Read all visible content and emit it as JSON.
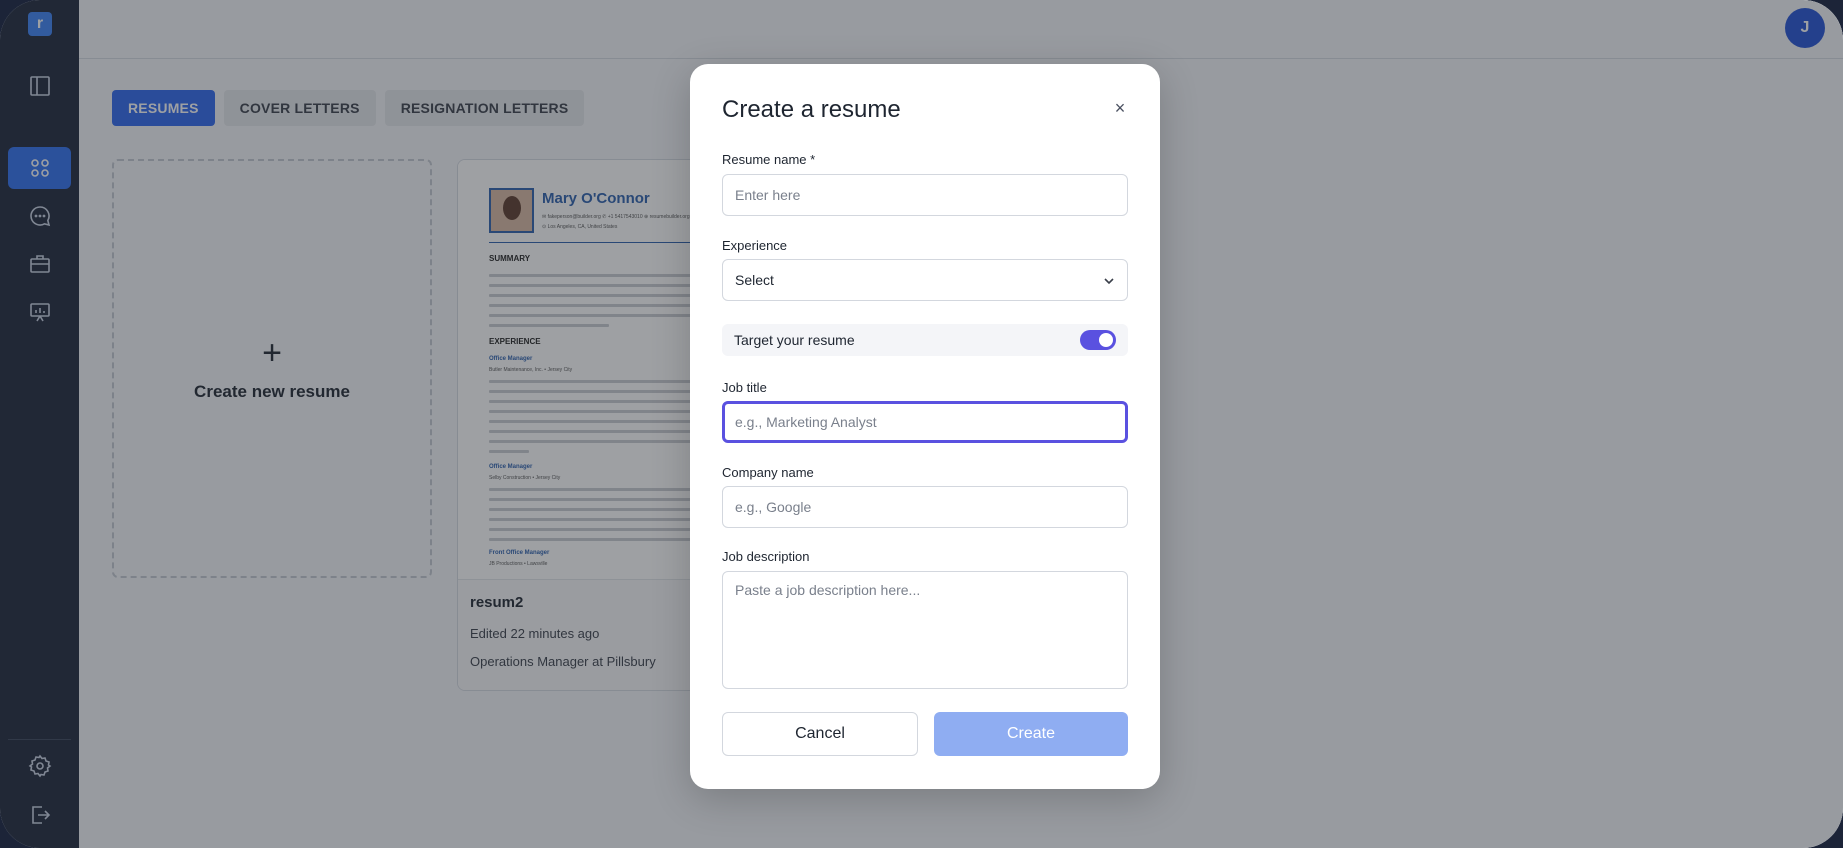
{
  "app": {
    "logo_letter": "r",
    "brand_color": "#2c66ee",
    "accent_color": "#5a51e0"
  },
  "sidebar": {
    "items": [
      {
        "icon": "sidebar-toggle-icon"
      },
      {
        "icon": "grid-icon",
        "active": true
      },
      {
        "icon": "chat-icon"
      },
      {
        "icon": "briefcase-icon"
      },
      {
        "icon": "presentation-icon"
      }
    ],
    "bottom": [
      {
        "icon": "gear-icon"
      },
      {
        "icon": "logout-icon"
      }
    ]
  },
  "header": {
    "avatar_initial": "J"
  },
  "tabs": [
    {
      "label": "RESUMES",
      "active": true
    },
    {
      "label": "COVER LETTERS"
    },
    {
      "label": "RESIGNATION LETTERS"
    }
  ],
  "new_card": {
    "plus": "+",
    "label": "Create new resume"
  },
  "resume_card": {
    "preview_name": "Mary O'Connor",
    "preview_contact": "✉ fakeperson@builder.org  ✆ +1 5417543010  ⊕ resumebuilder.org",
    "preview_location": "⊙ Los Angeles, CA, United States",
    "preview_summary_heading": "SUMMARY",
    "preview_experience_heading": "EXPERIENCE",
    "preview_job1": "Office Manager",
    "preview_job1_company": "Butler Maintenance, Inc.  •  Jersey City",
    "preview_job2": "Office Manager",
    "preview_job2_company": "Selby Construction  •  Jersey City",
    "preview_job3": "Front Office Manager",
    "preview_job3_company": "JB Productions  •  Lawsville",
    "title": "resum2",
    "edited": "Edited 22 minutes ago",
    "job": "Operations Manager at Pillsbury"
  },
  "modal": {
    "title": "Create a resume",
    "close": "×",
    "resume_name": {
      "label": "Resume name *",
      "placeholder": "Enter here",
      "value": ""
    },
    "experience": {
      "label": "Experience",
      "value": "Select"
    },
    "target": {
      "label": "Target your resume",
      "enabled": true
    },
    "job_title": {
      "label": "Job title",
      "placeholder": "e.g., Marketing Analyst",
      "value": ""
    },
    "company_name": {
      "label": "Company name",
      "placeholder": "e.g., Google",
      "value": ""
    },
    "job_description": {
      "label": "Job description",
      "placeholder": "Paste a job description here...",
      "value": ""
    },
    "cancel_label": "Cancel",
    "create_label": "Create"
  }
}
